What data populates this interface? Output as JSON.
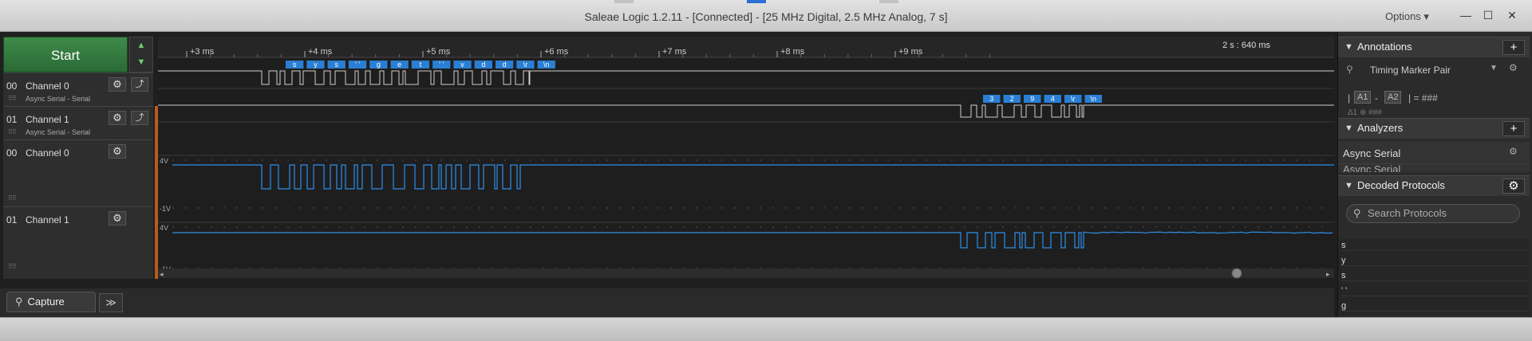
{
  "window": {
    "title": "Saleae Logic 1.2.11 - [Connected] - [25 MHz Digital, 2.5 MHz Analog, 7 s]",
    "options_label": "Options ▾",
    "minimize": "—",
    "maximize": "☐",
    "close": "✕"
  },
  "controls": {
    "start_label": "Start",
    "up_arrow": "▲",
    "down_arrow": "▼"
  },
  "timeline": {
    "position": "2 s : 640 ms",
    "ticks": [
      "+3 ms",
      "+4 ms",
      "+5 ms",
      "+6 ms",
      "+7 ms",
      "+8 ms",
      "+9 ms"
    ]
  },
  "channels": [
    {
      "num": "00",
      "name": "Channel 0",
      "sub": "Async Serial - Serial",
      "kind": "digital"
    },
    {
      "num": "01",
      "name": "Channel 1",
      "sub": "Async Serial - Serial",
      "kind": "digital"
    },
    {
      "num": "00",
      "name": "Channel 0",
      "sub": "",
      "kind": "analog"
    },
    {
      "num": "01",
      "name": "Channel 1",
      "sub": "",
      "kind": "analog"
    }
  ],
  "decoded": {
    "ch0": [
      "s",
      "y",
      "s",
      "' '",
      "g",
      "e",
      "t",
      "' '",
      "v",
      "d",
      "d",
      "\\r",
      "\\n"
    ],
    "ch1": [
      "3",
      "2",
      "9",
      "4",
      "\\r",
      "\\n"
    ]
  },
  "analog_labels": {
    "top": "4V",
    "bottom": "-1V"
  },
  "tabs": {
    "capture_label": "Capture",
    "more_label": "≫"
  },
  "annotations": {
    "header": "Annotations",
    "add": "+",
    "marker_type": "Timing Marker Pair",
    "measure_a1": "A1",
    "measure_sep": "-",
    "measure_a2": "A2",
    "measure_value": "| = ###",
    "measure_sub": "Δ1  ⊕  ###"
  },
  "analyzers": {
    "header": "Analyzers",
    "add": "+",
    "items": [
      "Async Serial",
      "Async Serial"
    ]
  },
  "decoded_protocols": {
    "header": "Decoded Protocols",
    "search_placeholder": "Search Protocols",
    "items": [
      "s",
      "y",
      "s",
      "' '",
      "g"
    ]
  },
  "colors": {
    "accent_green": "#2f7a3c",
    "wave_blue": "#2f8ee8",
    "label_blue": "#2a7fd4",
    "orange_bar": "#b85a1f"
  }
}
